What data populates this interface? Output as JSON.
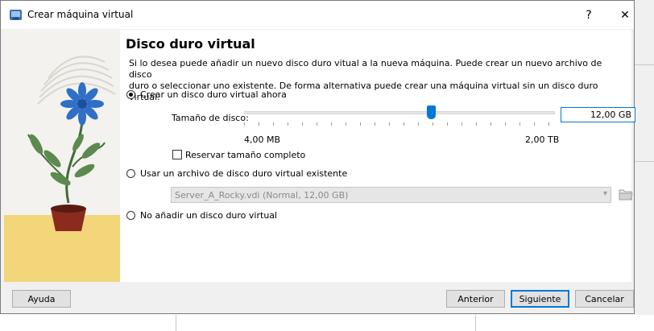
{
  "window": {
    "title": "Crear máquina virtual",
    "help_glyph": "?",
    "close_glyph": "✕",
    "icon": "virtualbox-icon"
  },
  "page": {
    "heading": "Disco duro virtual",
    "description_line1": "Si lo desea puede añadir un nuevo disco duro vitual a la nueva máquina. Puede crear un nuevo archivo de disco",
    "description_line2": "duro o seleccionar uno existente. De forma alternativa puede crear una máquina virtual sin un disco duro virtual."
  },
  "options": {
    "create_new": {
      "label": "Crear un disco duro virtual ahora",
      "selected": true
    },
    "disk_size_label": "Tamaño de disco:",
    "disk_size_value": "12,00 GB",
    "disk_size_fraction": 0.6,
    "slider_min_label": "4,00 MB",
    "slider_max_label": "2,00 TB",
    "preallocate": {
      "label": "Reservar tamaño completo",
      "checked": false
    },
    "use_existing": {
      "label": "Usar un archivo de disco duro virtual existente",
      "selected": false
    },
    "existing_file": "Server_A_Rocky.vdi (Normal, 12,00 GB)",
    "no_disk": {
      "label": "No añadir un disco duro virtual",
      "selected": false
    }
  },
  "buttons": {
    "help": "Ayuda",
    "back": "Anterior",
    "next": "Siguiente",
    "cancel": "Cancelar"
  },
  "colors": {
    "accent": "#0078d7",
    "dialog_bg": "#f0f0f0",
    "illustration_sun": "#f3d57a"
  }
}
